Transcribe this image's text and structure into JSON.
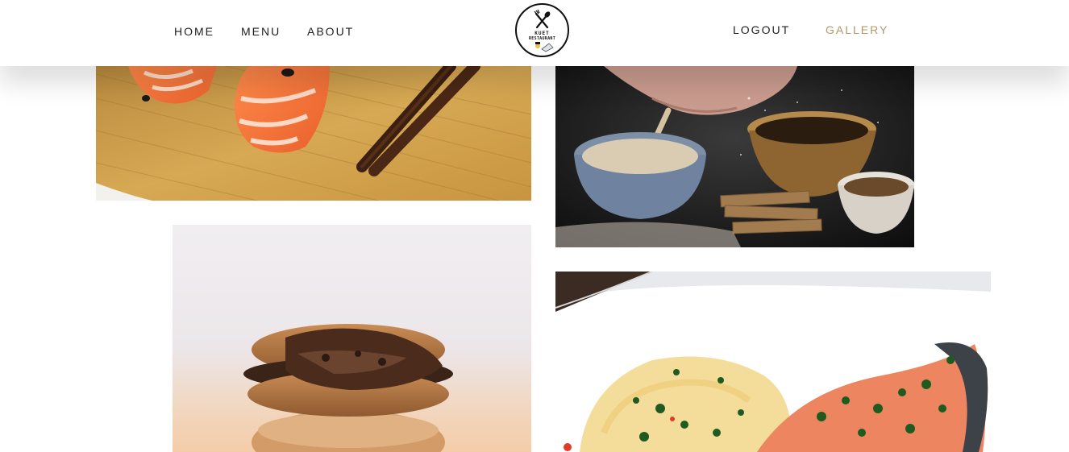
{
  "nav": {
    "left": [
      {
        "label": "HOME"
      },
      {
        "label": "MENU"
      },
      {
        "label": "ABOUT"
      }
    ],
    "right": [
      {
        "label": "LOGOUT"
      },
      {
        "label": "GALLERY",
        "active": true
      }
    ]
  },
  "logo": {
    "line1": "KUET",
    "line2": "RESTAURANT",
    "icon": "fork-knife-chef-icon"
  },
  "gallery": {
    "images": [
      {
        "name": "salmon-sushi-image",
        "subject": "salmon nigiri with chopsticks on bamboo board"
      },
      {
        "name": "flour-bowls-image",
        "subject": "hand sprinkling flour over bowls and crackers"
      },
      {
        "name": "macaron-image",
        "subject": "bitten chocolate macaron stack"
      },
      {
        "name": "grilled-fish-image",
        "subject": "herb-crusted salmon with mashed potatoes"
      }
    ]
  },
  "colors": {
    "accent": "#b5976a",
    "nav_text": "#1f1f1f",
    "background": "#ffffff"
  }
}
